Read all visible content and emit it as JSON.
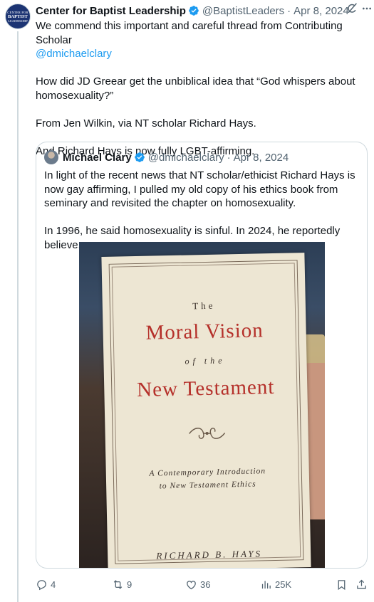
{
  "post": {
    "avatar_text": [
      "CENTER FOR",
      "BAPTIST",
      "LEADERSHIP"
    ],
    "author_name": "Center for Baptist Leadership",
    "handle": "@BaptistLeaders",
    "separator": "·",
    "date": "Apr 8, 2024",
    "text_line1": "We commend this important and careful thread from Contributing Scholar",
    "mention": "@dmichaelclary",
    "paragraph2": "How did JD Greear get the unbiblical idea that “God whispers about homosexuality?”",
    "paragraph3": "From Jen Wilkin, via NT scholar Richard Hays.",
    "paragraph4": "And Richard Hays is now fully LGBT-affirming."
  },
  "quote": {
    "author_name": "Michael Clary",
    "handle": "@dmichaelclary",
    "separator": "·",
    "date": "Apr 8, 2024",
    "paragraph1": "In light of the recent news that NT scholar/ethicist Richard Hays is now gay affirming, I pulled my old copy of his ethics book from seminary and revisited the chapter on homosexuality.",
    "paragraph2": "In 1996, he said homosexuality is sinful. In 2024, he reportedly believe..."
  },
  "book": {
    "the": "The",
    "title1": "Moral Vision",
    "of_the": "of the",
    "title2": "New Testament",
    "subtitle1": "A Contemporary Introduction",
    "subtitle2": "to New Testament Ethics",
    "author": "RICHARD B. HAYS"
  },
  "actions": {
    "replies": "4",
    "reposts": "9",
    "likes": "36",
    "views": "25K"
  },
  "colors": {
    "link": "#1d9bf0",
    "secondary_text": "#536471",
    "verified": "#1d9bf0",
    "book_red": "#b5302a"
  },
  "icons": [
    "verified-badge-icon",
    "grok-icon",
    "more-icon",
    "reply-icon",
    "repost-icon",
    "like-icon",
    "views-icon",
    "bookmark-icon",
    "share-icon"
  ]
}
